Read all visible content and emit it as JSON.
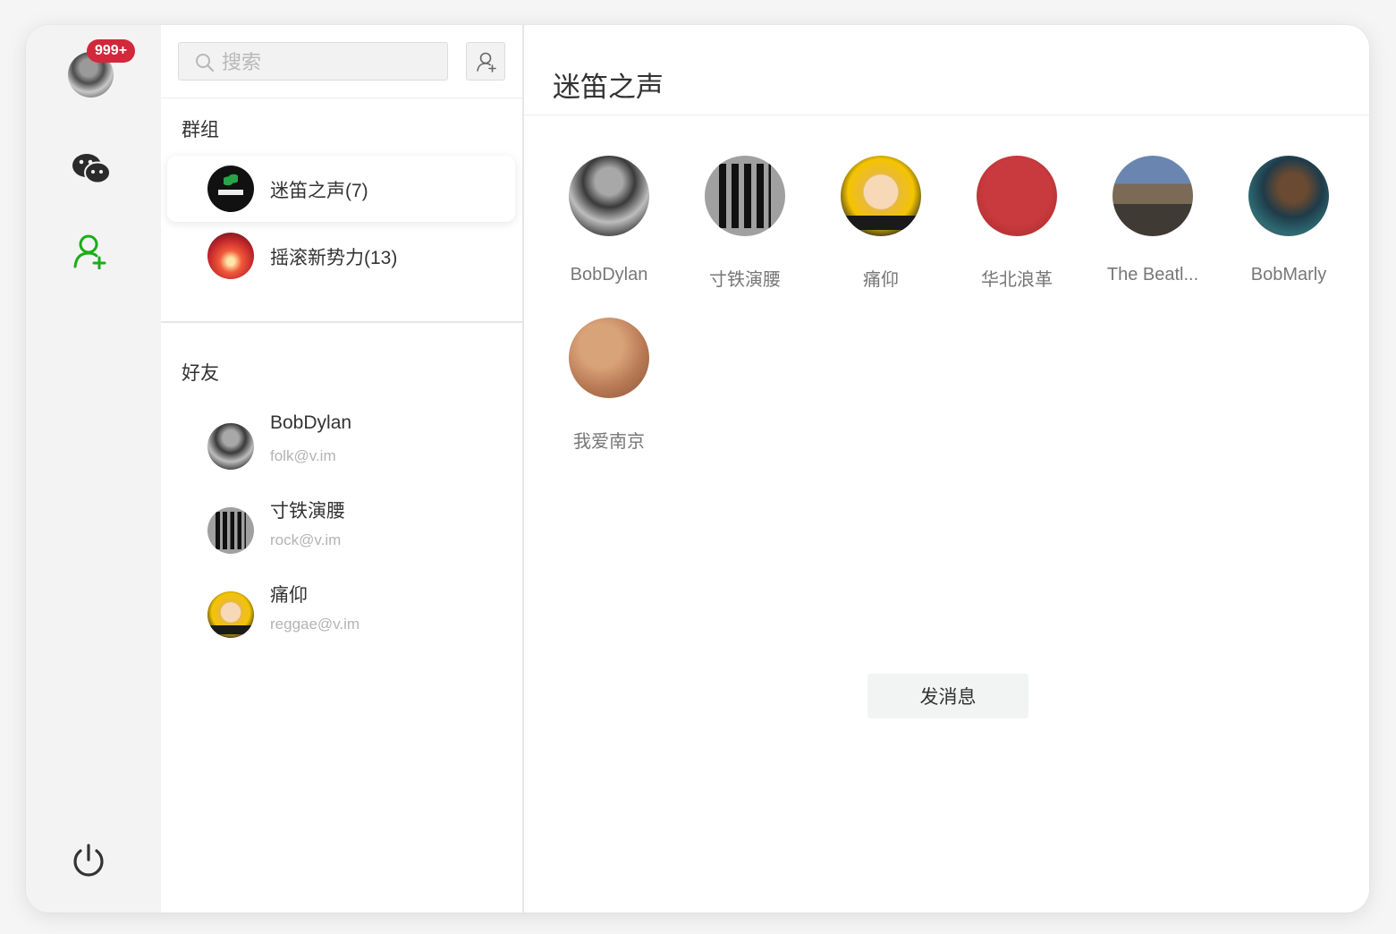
{
  "rail": {
    "badge": "999+",
    "icons": [
      "avatar",
      "chat-icon",
      "contacts-add-icon",
      "power-icon"
    ],
    "accent": "#1aad19"
  },
  "search": {
    "placeholder": "搜索"
  },
  "groups": {
    "title": "群组",
    "items": [
      {
        "name": "迷笛之声(7)",
        "active": true
      },
      {
        "name": "摇滚新势力(13)",
        "active": false
      }
    ]
  },
  "friends": {
    "title": "好友",
    "items": [
      {
        "name": "BobDylan",
        "email": "folk@v.im"
      },
      {
        "name": "寸铁演腰",
        "email": "rock@v.im"
      },
      {
        "name": "痛仰",
        "email": "reggae@v.im"
      }
    ]
  },
  "detail": {
    "title": "迷笛之声",
    "members": [
      {
        "name": "BobDylan"
      },
      {
        "name": "寸铁演腰"
      },
      {
        "name": "痛仰"
      },
      {
        "name": "华北浪革"
      },
      {
        "name": "The Beatl..."
      },
      {
        "name": "BobMarly"
      },
      {
        "name": "我爱南京"
      }
    ],
    "send_label": "发消息"
  }
}
